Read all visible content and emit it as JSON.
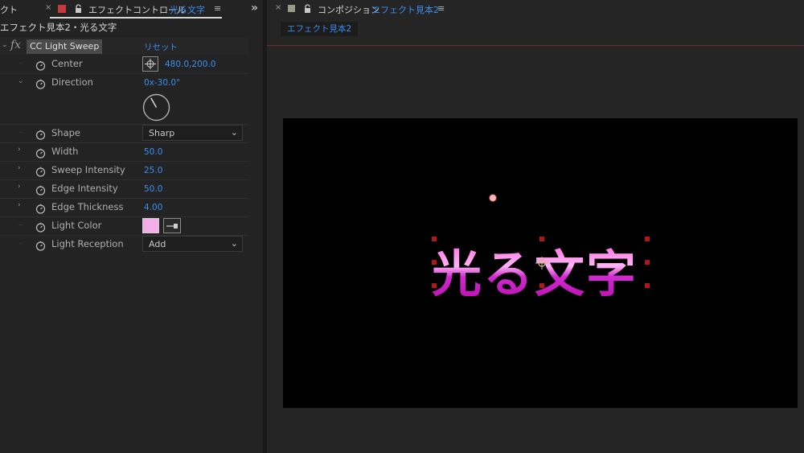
{
  "left_panel": {
    "partial_tab": "クト",
    "tab_close": "×",
    "tab_title": "エフェクトコントロール",
    "tab_layer": "光る文字",
    "menu": "≡",
    "expand": "»",
    "header": "エフェクト見本2・光る文字",
    "effect": {
      "name": "CC Light Sweep",
      "reset": "リセット"
    },
    "properties": {
      "center": {
        "label": "Center",
        "value": "480.0,200.0"
      },
      "direction": {
        "label": "Direction",
        "value": "0x-30.0°",
        "angle_deg": -30
      },
      "shape": {
        "label": "Shape",
        "value": "Sharp"
      },
      "width": {
        "label": "Width",
        "value": "50.0"
      },
      "sweep_intensity": {
        "label": "Sweep Intensity",
        "value": "25.0"
      },
      "edge_intensity": {
        "label": "Edge Intensity",
        "value": "50.0"
      },
      "edge_thickness": {
        "label": "Edge Thickness",
        "value": "4.00"
      },
      "light_color": {
        "label": "Light Color",
        "color": "#f2aee8"
      },
      "light_reception": {
        "label": "Light Reception",
        "value": "Add"
      }
    }
  },
  "right_panel": {
    "tab_close": "×",
    "tab_title": "コンポジション",
    "tab_comp": "エフェクト見本2",
    "menu": "≡",
    "breadcrumb": "エフェクト見本2",
    "canvas_text": "光る文字"
  },
  "colors": {
    "accent": "#3b8df0",
    "panel_bg": "#232323",
    "text_fill": "#ff55f0",
    "light_color": "#f2aee8"
  }
}
